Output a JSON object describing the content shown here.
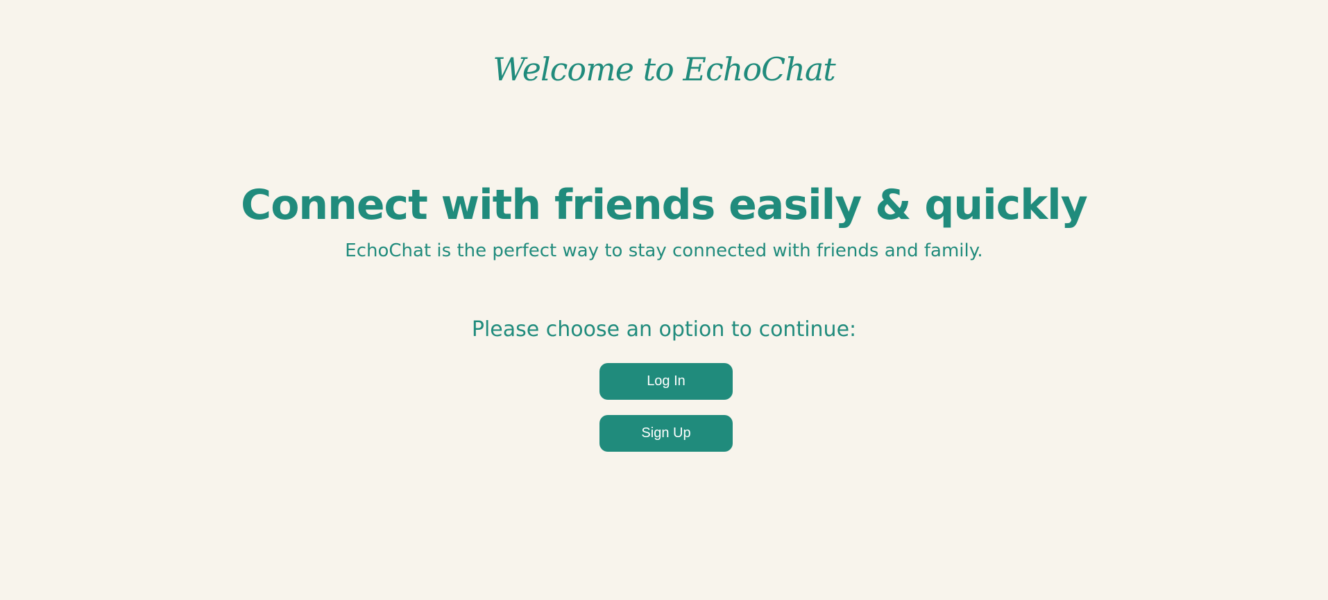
{
  "header": {
    "welcome_title": "Welcome to EchoChat"
  },
  "hero": {
    "headline": "Connect with friends easily & quickly",
    "tagline": "EchoChat is the perfect way to stay connected with friends and family."
  },
  "auth": {
    "prompt": "Please choose an option to continue:",
    "login_label": "Log In",
    "signup_label": "Sign Up"
  },
  "colors": {
    "background": "#f8f4ec",
    "accent": "#208b7c",
    "button_text": "#ffffff"
  }
}
